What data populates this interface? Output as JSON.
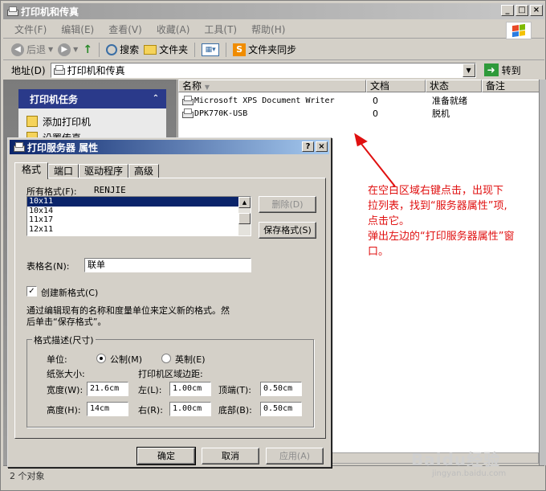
{
  "explorer": {
    "title": "打印机和传真",
    "menu": [
      "文件(F)",
      "编辑(E)",
      "查看(V)",
      "收藏(A)",
      "工具(T)",
      "帮助(H)"
    ],
    "toolbar": {
      "back": "后退",
      "search": "搜索",
      "folders": "文件夹",
      "folder_sync": "文件夹同步"
    },
    "address_label": "地址(D)",
    "address_value": "打印机和传真",
    "goto_label": "转到",
    "task_pane": {
      "header": "打印机任务",
      "items": [
        "添加打印机",
        "设置传真"
      ]
    },
    "list": {
      "columns": [
        "名称",
        "文档",
        "状态",
        "备注"
      ],
      "rows": [
        {
          "name": "Microsoft XPS Document Writer",
          "docs": "0",
          "status": "准备就绪"
        },
        {
          "name": "DPK770K-USB",
          "docs": "0",
          "status": "脱机"
        }
      ]
    },
    "status_text": "2 个对象"
  },
  "annotation": {
    "lines": [
      "在空白区域右键点击，出现下",
      "拉列表，找到“服务器属性”项,",
      "点击它。",
      "弹出左边的“打印服务器属性”窗",
      "口。"
    ],
    "color": "#e01010"
  },
  "watermark": {
    "main": "Baidu经验",
    "sub": "jingyan.baidu.com"
  },
  "dialog": {
    "title": "打印服务器 属性",
    "tabs": [
      "格式",
      "端口",
      "驱动程序",
      "高级"
    ],
    "all_formats_label": "所有格式(F):",
    "server_name": "RENJIE",
    "formats": [
      "10x11",
      "10x14",
      "11x17",
      "12x11"
    ],
    "delete_label": "删除(D)",
    "save_format_label": "保存格式(S)",
    "form_name_label": "表格名(N):",
    "form_name_value": "联单",
    "create_new_label": "创建新格式(C)",
    "description_line1": "通过编辑现有的名称和度量单位来定义新的格式。然",
    "description_line2": "后单击“保存格式”。",
    "group_title": "格式描述(尺寸)",
    "unit_label": "单位:",
    "metric_label": "公制(M)",
    "imperial_label": "英制(E)",
    "paper_size_label": "纸张大小:",
    "margins_label": "打印机区域边距:",
    "width_label": "宽度(W):",
    "width_value": "21.6cm",
    "height_label": "高度(H):",
    "height_value": "14cm",
    "left_label": "左(L):",
    "left_value": "1.00cm",
    "right_label": "右(R):",
    "right_value": "1.00cm",
    "top_label": "顶端(T):",
    "top_value": "0.50cm",
    "bottom_label": "底部(B):",
    "bottom_value": "0.50cm",
    "ok_label": "确定",
    "cancel_label": "取消",
    "apply_label": "应用(A)"
  }
}
